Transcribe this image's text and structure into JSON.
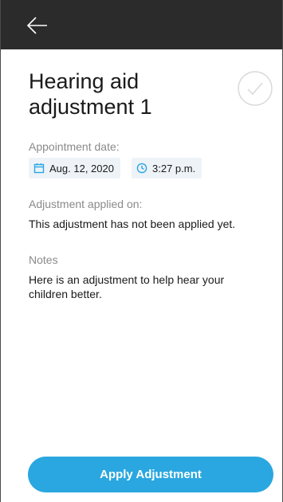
{
  "header": {
    "back_icon": "arrow-left-icon"
  },
  "detail": {
    "title_line1": "Hearing aid",
    "title_line2": "adjustment 1",
    "status_icon": "check-circle-icon",
    "appointment_label": "Appointment date:",
    "appointment_date": "Aug. 12, 2020",
    "appointment_time": "3:27 p.m.",
    "applied_label": "Adjustment applied on:",
    "applied_value": "This adjustment has not been applied yet.",
    "notes_label": "Notes",
    "notes_value": "Here is an adjustment to help hear your children better."
  },
  "actions": {
    "apply_label": "Apply Adjustment"
  },
  "colors": {
    "header_bg": "#2b2b2b",
    "accent": "#2aa7e0",
    "chip_bg": "#eef3f8",
    "label_text": "#8a8a8a"
  }
}
